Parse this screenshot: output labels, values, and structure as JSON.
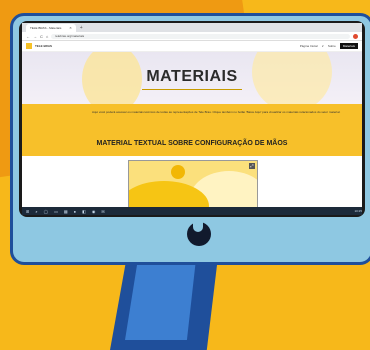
{
  "browser": {
    "tab_title": "TELE BRAS - Materiais",
    "tab_close": "×",
    "new_tab": "+",
    "url": "telebras.org/materiais",
    "nav_back": "←",
    "nav_forward": "→",
    "nav_reload": "C",
    "home": "⌂"
  },
  "site": {
    "logo_text": "TELE BRAS",
    "menu_items": [
      "Página Inicial",
      "∨",
      "Sobre"
    ],
    "menu_button": "Materiais",
    "hero_title": "MATERIAIS",
    "intro_text": "Aqui você poderá acessar os materiais técnicos de todas as representações de Tele Bras. Clique também no botão 'Baixe Aqui' para visualizar os materiais relacionados do setor material.",
    "section_title": "MATERIAL TEXTUAL SOBRE CONFIGURAÇÃO DE MÃOS",
    "preview_close": "⤢",
    "hand": "✋"
  },
  "taskbar": {
    "icons": [
      "⊞",
      "⌕",
      "◯",
      "▭",
      "▦",
      "●",
      "◧",
      "◉",
      "✉"
    ],
    "clock": "10:25"
  },
  "colors": {
    "background": "#f7b81a",
    "monitor": "#8ec8e2",
    "accent_band": "#f7c02a",
    "stand": "#1f4f9b"
  }
}
